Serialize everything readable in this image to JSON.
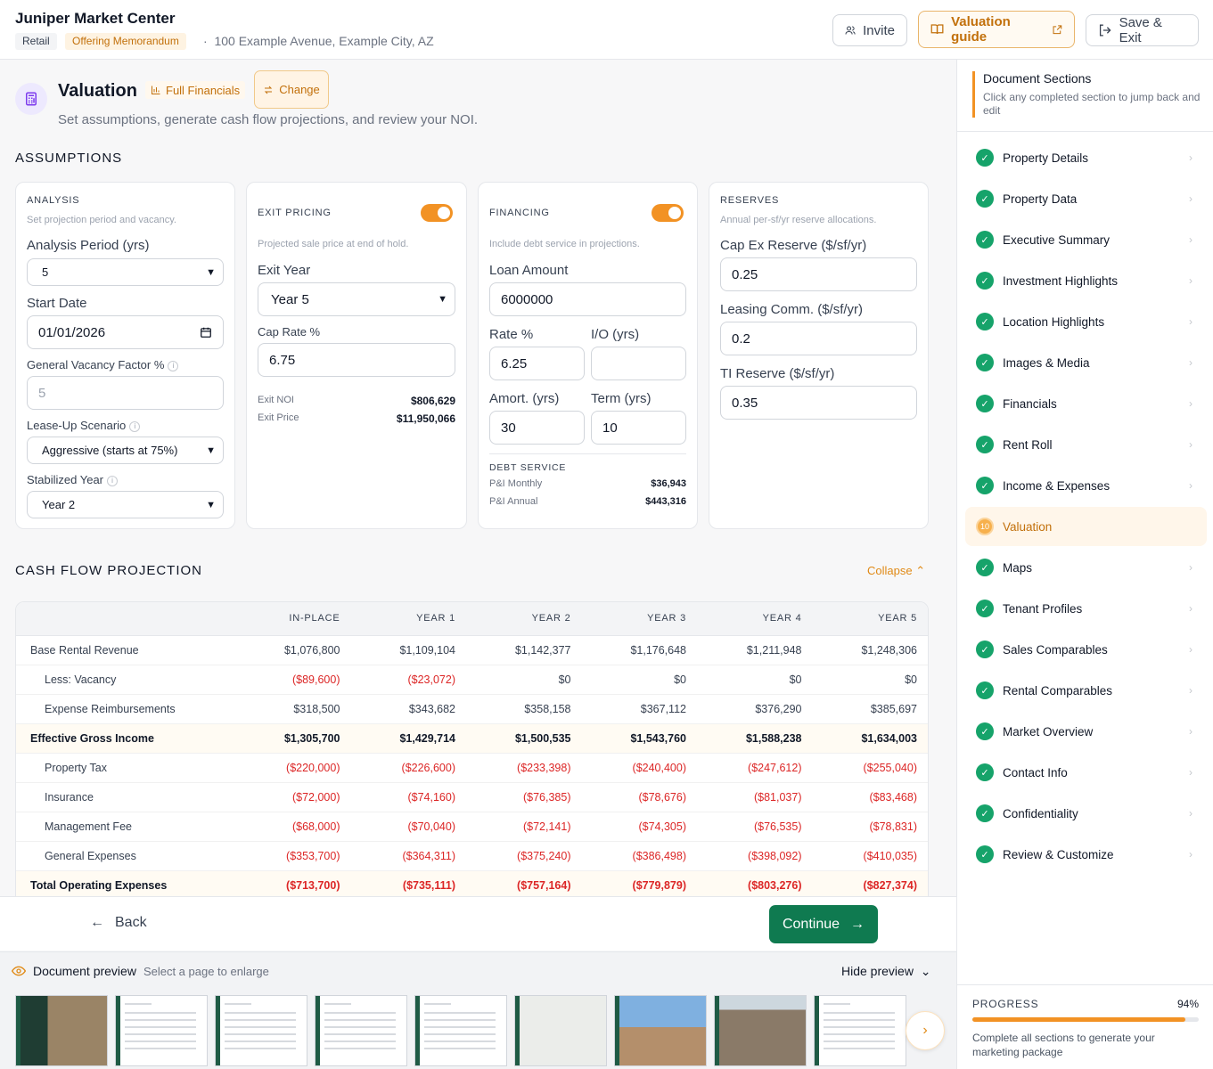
{
  "header": {
    "title": "Juniper Market Center",
    "tag_retail": "Retail",
    "tag_om": "Offering Memorandum",
    "address": "100 Example Avenue, Example City, AZ",
    "invite": "Invite",
    "valuation_guide": "Valuation guide",
    "save_exit": "Save & Exit"
  },
  "valuation": {
    "title": "Valuation",
    "full_financials": "Full Financials",
    "change": "Change",
    "subtitle": "Set assumptions, generate cash flow projections, and review your NOI."
  },
  "assumptions_title": "ASSUMPTIONS",
  "analysis": {
    "head": "ANALYSIS",
    "sub": "Set projection period and vacancy.",
    "period_label": "Analysis Period (yrs)",
    "period_value": "5",
    "start_label": "Start Date",
    "start_value": "01/01/2026",
    "vacancy_label": "General Vacancy Factor %",
    "vacancy_placeholder": "5",
    "leaseup_label": "Lease-Up Scenario",
    "leaseup_value": "Aggressive (starts at 75%)",
    "stabilized_label": "Stabilized Year",
    "stabilized_value": "Year 2"
  },
  "exit": {
    "head": "EXIT PRICING",
    "sub": "Projected sale price at end of hold.",
    "year_label": "Exit Year",
    "year_value": "Year 5",
    "cap_label": "Cap Rate %",
    "cap_value": "6.75",
    "noi_label": "Exit NOI",
    "noi_value": "$806,629",
    "price_label": "Exit Price",
    "price_value": "$11,950,066"
  },
  "financing": {
    "head": "FINANCING",
    "sub": "Include debt service in projections.",
    "loan_label": "Loan Amount",
    "loan_value": "6000000",
    "rate_label": "Rate %",
    "rate_value": "6.25",
    "io_label": "I/O (yrs)",
    "io_value": "",
    "amort_label": "Amort. (yrs)",
    "amort_value": "30",
    "term_label": "Term (yrs)",
    "term_value": "10",
    "ds_head": "DEBT SERVICE",
    "monthly_label": "P&I Monthly",
    "monthly_value": "$36,943",
    "annual_label": "P&I Annual",
    "annual_value": "$443,316"
  },
  "reserves": {
    "head": "RESERVES",
    "sub": "Annual per-sf/yr reserve allocations.",
    "capex_label": "Cap Ex Reserve ($/sf/yr)",
    "capex_value": "0.25",
    "leasing_label": "Leasing Comm. ($/sf/yr)",
    "leasing_value": "0.2",
    "ti_label": "TI Reserve ($/sf/yr)",
    "ti_value": "0.35"
  },
  "cashflow": {
    "title": "CASH FLOW PROJECTION",
    "collapse": "Collapse",
    "columns": [
      "",
      "IN-PLACE",
      "YEAR 1",
      "YEAR 2",
      "YEAR 3",
      "YEAR 4",
      "YEAR 5"
    ],
    "rows": [
      {
        "label": "Base Rental Revenue",
        "indent": false,
        "bold": false,
        "neg": false,
        "values": [
          "$1,076,800",
          "$1,109,104",
          "$1,142,377",
          "$1,176,648",
          "$1,211,948",
          "$1,248,306"
        ]
      },
      {
        "label": "Less: Vacancy",
        "indent": true,
        "bold": false,
        "neg": true,
        "values": [
          "($89,600)",
          "($23,072)",
          "$0",
          "$0",
          "$0",
          "$0"
        ]
      },
      {
        "label": "Expense Reimbursements",
        "indent": true,
        "bold": false,
        "neg": false,
        "values": [
          "$318,500",
          "$343,682",
          "$358,158",
          "$367,112",
          "$376,290",
          "$385,697"
        ]
      },
      {
        "label": "Effective Gross Income",
        "indent": false,
        "bold": true,
        "neg": false,
        "values": [
          "$1,305,700",
          "$1,429,714",
          "$1,500,535",
          "$1,543,760",
          "$1,588,238",
          "$1,634,003"
        ]
      },
      {
        "label": "Property Tax",
        "indent": true,
        "bold": false,
        "neg": true,
        "values": [
          "($220,000)",
          "($226,600)",
          "($233,398)",
          "($240,400)",
          "($247,612)",
          "($255,040)"
        ]
      },
      {
        "label": "Insurance",
        "indent": true,
        "bold": false,
        "neg": true,
        "values": [
          "($72,000)",
          "($74,160)",
          "($76,385)",
          "($78,676)",
          "($81,037)",
          "($83,468)"
        ]
      },
      {
        "label": "Management Fee",
        "indent": true,
        "bold": false,
        "neg": true,
        "values": [
          "($68,000)",
          "($70,040)",
          "($72,141)",
          "($74,305)",
          "($76,535)",
          "($78,831)"
        ]
      },
      {
        "label": "General Expenses",
        "indent": true,
        "bold": false,
        "neg": true,
        "values": [
          "($353,700)",
          "($364,311)",
          "($375,240)",
          "($386,498)",
          "($398,092)",
          "($410,035)"
        ]
      },
      {
        "label": "Total Operating Expenses",
        "indent": false,
        "bold": true,
        "neg": true,
        "values": [
          "($713,700)",
          "($735,111)",
          "($757,164)",
          "($779,879)",
          "($803,276)",
          "($827,374)"
        ]
      }
    ]
  },
  "nav": {
    "back": "Back",
    "continue": "Continue"
  },
  "preview": {
    "title": "Document preview",
    "hint": "Select a page to enlarge",
    "hide": "Hide preview",
    "thumbs": [
      "dark",
      "doc",
      "doc",
      "doc",
      "doc",
      "map",
      "sky",
      "store",
      "doc"
    ]
  },
  "sidebar": {
    "title": "Document Sections",
    "subtitle": "Click any completed section to jump back and edit",
    "items": [
      {
        "label": "Property Details",
        "active": false
      },
      {
        "label": "Property Data",
        "active": false
      },
      {
        "label": "Executive Summary",
        "active": false
      },
      {
        "label": "Investment Highlights",
        "active": false
      },
      {
        "label": "Location Highlights",
        "active": false
      },
      {
        "label": "Images & Media",
        "active": false
      },
      {
        "label": "Financials",
        "active": false
      },
      {
        "label": "Rent Roll",
        "active": false
      },
      {
        "label": "Income & Expenses",
        "active": false
      },
      {
        "label": "Valuation",
        "active": true,
        "number": "10"
      },
      {
        "label": "Maps",
        "active": false
      },
      {
        "label": "Tenant Profiles",
        "active": false
      },
      {
        "label": "Sales Comparables",
        "active": false
      },
      {
        "label": "Rental Comparables",
        "active": false
      },
      {
        "label": "Market Overview",
        "active": false
      },
      {
        "label": "Contact Info",
        "active": false
      },
      {
        "label": "Confidentiality",
        "active": false
      },
      {
        "label": "Review & Customize",
        "active": false
      }
    ],
    "progress_label": "PROGRESS",
    "progress_value": "94%",
    "progress_fraction": 0.94,
    "progress_note": "Complete all sections to generate your marketing package"
  }
}
